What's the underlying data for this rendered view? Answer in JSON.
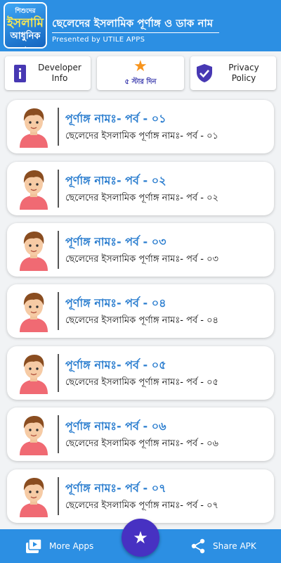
{
  "header": {
    "logo_lines": [
      "শিশুদের",
      "ইসলামি",
      "আধুনিক নাম",
      "নাম"
    ],
    "title": "ছেলেদের ইসলামিক পূর্ণাঙ্গ ও ডাক নাম",
    "subtitle": "Presented by UTILE APPS"
  },
  "top_buttons": [
    {
      "label_line1": "Developer",
      "label_line2": "Info",
      "icon": "info-icon"
    },
    {
      "label": "৫ স্টার দিন",
      "icon": "star-icon"
    },
    {
      "label_line1": "Privacy",
      "label_line2": "Policy",
      "icon": "shield-icon"
    }
  ],
  "episodes": [
    {
      "title": "পূর্ণাঙ্গ নামঃ- পর্ব - ০১",
      "subtitle": "ছেলেদের ইসলামিক পূর্ণাঙ্গ নামঃ- পর্ব - ০১"
    },
    {
      "title": "পূর্ণাঙ্গ নামঃ- পর্ব - ০২",
      "subtitle": "ছেলেদের ইসলামিক পূর্ণাঙ্গ নামঃ- পর্ব - ০২"
    },
    {
      "title": "পূর্ণাঙ্গ নামঃ- পর্ব - ০৩",
      "subtitle": "ছেলেদের ইসলামিক পূর্ণাঙ্গ নামঃ- পর্ব - ০৩"
    },
    {
      "title": "পূর্ণাঙ্গ নামঃ- পর্ব - ০৪",
      "subtitle": "ছেলেদের ইসলামিক পূর্ণাঙ্গ নামঃ- পর্ব - ০৪"
    },
    {
      "title": "পূর্ণাঙ্গ নামঃ- পর্ব - ০৫",
      "subtitle": "ছেলেদের ইসলামিক পূর্ণাঙ্গ নামঃ- পর্ব - ০৫"
    },
    {
      "title": "পূর্ণাঙ্গ নামঃ- পর্ব - ০৬",
      "subtitle": "ছেলেদের ইসলামিক পূর্ণাঙ্গ নামঃ- পর্ব - ০৬"
    },
    {
      "title": "পূর্ণাঙ্গ নামঃ- পর্ব - ০৭",
      "subtitle": "ছেলেদের ইসলামিক পূর্ণাঙ্গ নামঃ- পর্ব - ০৭"
    }
  ],
  "bottom_bar": {
    "left_label": "More Apps",
    "left_icon": "more-apps-icon",
    "right_label": "Share APK",
    "right_icon": "share-icon",
    "fab_icon": "star-icon"
  },
  "colors": {
    "primary": "#2c8fe3",
    "accent": "#4731c2",
    "title_blue": "#2a7dcf",
    "star_orange": "#f7941d"
  }
}
